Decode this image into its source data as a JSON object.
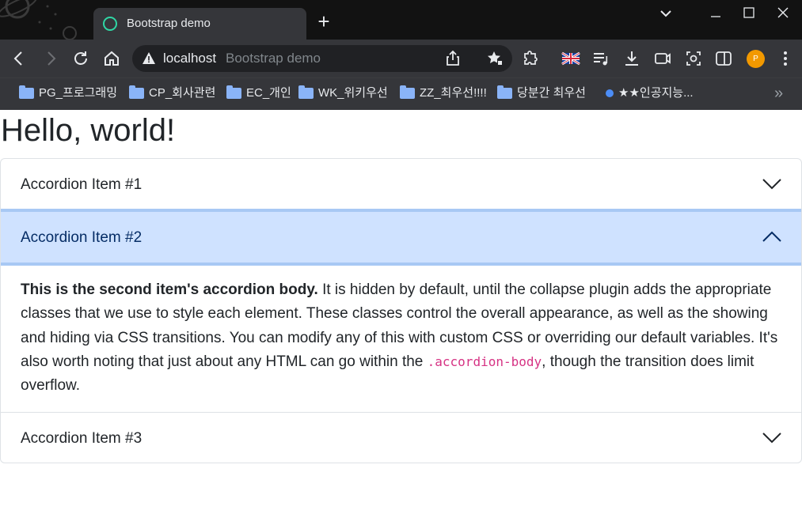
{
  "browser": {
    "tab_title": "Bootstrap demo",
    "new_tab_label": "+",
    "address": {
      "host": "localhost",
      "page_title": "Bootstrap demo"
    },
    "avatar_initial": "P",
    "bookmarks": [
      {
        "label": "PG_프로그래밍",
        "type": "folder"
      },
      {
        "label": "CP_회사관련",
        "type": "folder"
      },
      {
        "label": "EC_개인",
        "type": "folder"
      },
      {
        "label": "WK_위키우선",
        "type": "folder"
      },
      {
        "label": "ZZ_최우선!!!!",
        "type": "folder"
      },
      {
        "label": "당분간 최우선",
        "type": "folder"
      },
      {
        "label": "★★인공지능...",
        "type": "link"
      }
    ],
    "bookmarks_more": "»",
    "accent_color": "#2fd7a5",
    "avatar_color": "#f29900"
  },
  "page": {
    "heading": "Hello, world!",
    "accordion": {
      "items": [
        {
          "title": "Accordion Item #1",
          "expanded": false
        },
        {
          "title": "Accordion Item #2",
          "expanded": true
        },
        {
          "title": "Accordion Item #3",
          "expanded": false
        }
      ],
      "body": {
        "strong": "This is the second item's accordion body.",
        "text1": " It is hidden by default, until the collapse plugin adds the appropriate classes that we use to style each element. These classes control the overall appearance, as well as the showing and hiding via CSS transitions. You can modify any of this with custom CSS or overriding our default variables. It's also worth noting that just about any HTML can go within the ",
        "code": ".accordion-body",
        "text2": ", though the transition does limit overflow."
      },
      "active_bg": "#cfe2ff",
      "active_text_color": "#052c65",
      "code_color": "#d63384"
    }
  }
}
